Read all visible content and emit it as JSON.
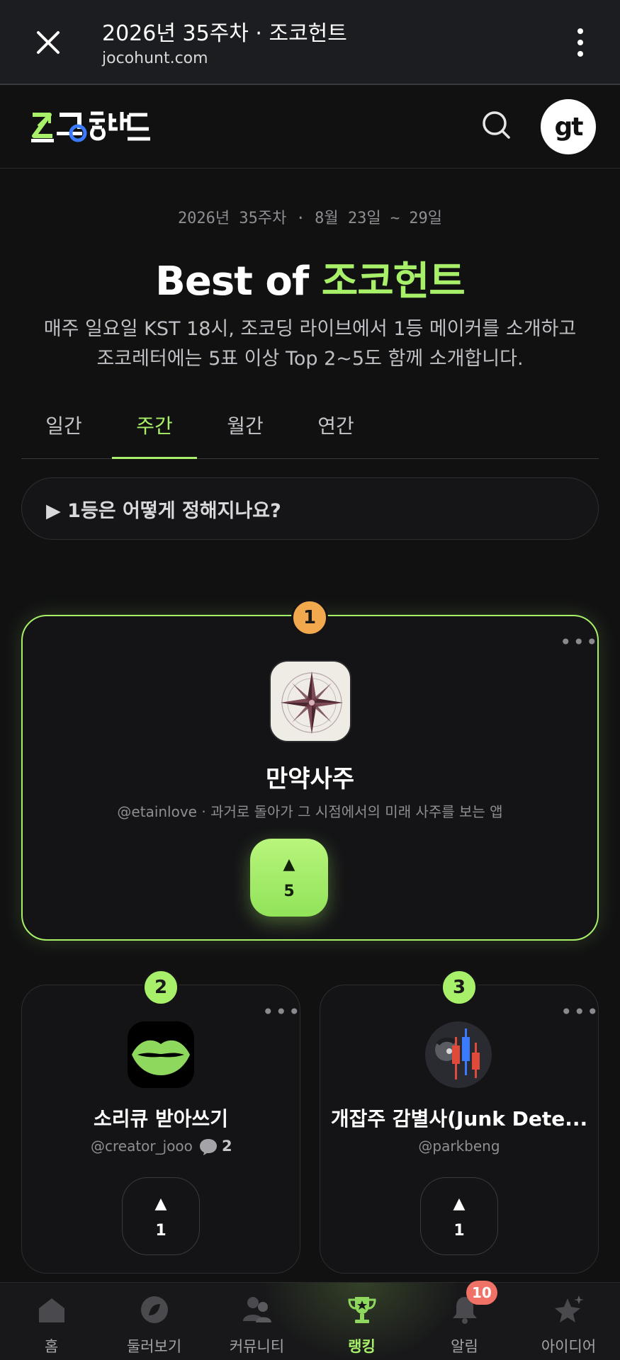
{
  "browser": {
    "title": "2026년 35주차 · 조코헌트",
    "url": "jocohunt.com"
  },
  "header": {
    "logo_text": "조코헌트",
    "avatar_text": "gt"
  },
  "hero": {
    "week_range": "2026년 35주차 · 8월 23일 ~ 29일",
    "title_prefix": "Best of ",
    "title_accent": "조코헌트",
    "description": "매주 일요일 KST 18시, 조코딩 라이브에서 1등 메이커를 소개하고 조코레터에는 5표 이상 Top 2~5도 함께 소개합니다."
  },
  "tabs": [
    {
      "label": "일간",
      "active": false
    },
    {
      "label": "주간",
      "active": true
    },
    {
      "label": "월간",
      "active": false
    },
    {
      "label": "연간",
      "active": false
    }
  ],
  "faq": {
    "label": "▶ 1등은 어떻게 정해지나요?"
  },
  "ranking": [
    {
      "rank": "1",
      "name": "만약사주",
      "subtitle": "@etainlove · 과거로 돌아가 그 시점에서의 미래 사주를 보는 앱",
      "votes": "5",
      "icon": "compass-icon"
    },
    {
      "rank": "2",
      "name": "소리큐 받아쓰기",
      "author": "@creator_jooo",
      "comments": "2",
      "votes": "1",
      "icon": "lips-icon"
    },
    {
      "rank": "3",
      "name": "개잡주 감별사(Junk Dete...",
      "author": "@parkbeng",
      "votes": "1",
      "icon": "candlestick-chart-icon"
    }
  ],
  "bottom_nav": [
    {
      "label": "홈",
      "icon": "home-icon"
    },
    {
      "label": "둘러보기",
      "icon": "explore-icon"
    },
    {
      "label": "커뮤니티",
      "icon": "community-icon"
    },
    {
      "label": "랭킹",
      "icon": "trophy-icon",
      "active": true
    },
    {
      "label": "알림",
      "icon": "bell-icon",
      "badge": "10"
    },
    {
      "label": "아이디어",
      "icon": "sparkle-icon"
    }
  ],
  "colors": {
    "accent": "#a8f06a",
    "gold": "#f2a94e",
    "badge_red": "#f07266",
    "background": "#111112"
  }
}
